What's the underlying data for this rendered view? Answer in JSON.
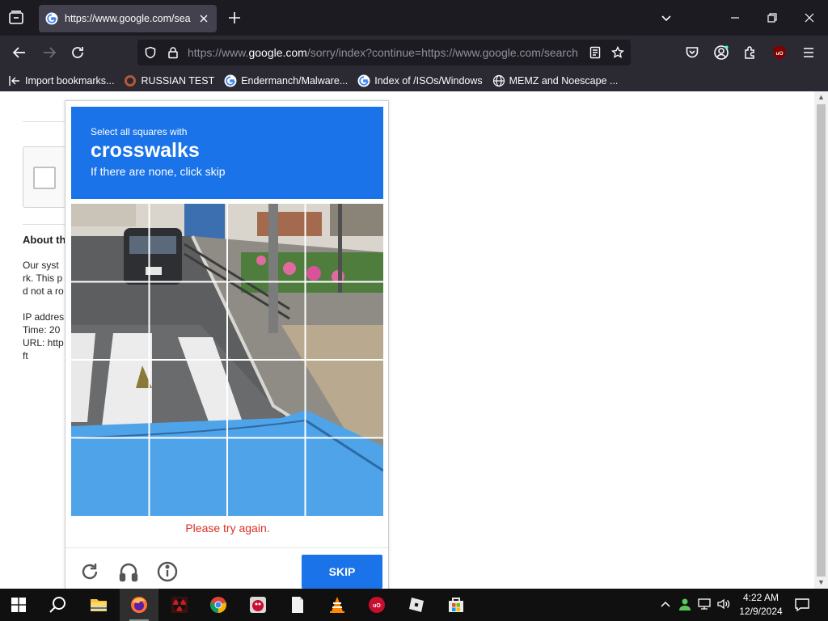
{
  "browser": {
    "tab": {
      "title": "https://www.google.com/search"
    },
    "url": {
      "prefix": "https://www.",
      "domain": "google.com",
      "path": "/sorry/index?continue=https://www.google.com/search"
    },
    "bookmarks": [
      {
        "label": "Import bookmarks...",
        "icon": "import-icon"
      },
      {
        "label": "RUSSIAN TEST",
        "icon": "site-icon"
      },
      {
        "label": "Endermanch/Malware...",
        "icon": "google-icon"
      },
      {
        "label": "Index of /ISOs/Windows",
        "icon": "google-icon"
      },
      {
        "label": "MEMZ and Noescape ...",
        "icon": "globe-icon"
      }
    ]
  },
  "page": {
    "about_title": "About th",
    "about_lines": [
      "Our syst",
      "rk. This p",
      "d not a ro",
      "",
      "IP addres",
      "Time: 20",
      "URL: http",
      "ft"
    ]
  },
  "challenge": {
    "instruction": "Select all squares with",
    "target": "crosswalks",
    "hint": "If there are none, click skip",
    "error": "Please try again.",
    "skip_label": "SKIP",
    "header_color": "#1a73e8",
    "error_color": "#d93025"
  },
  "taskbar": {
    "time": "4:22 AM",
    "date": "12/9/2024"
  }
}
